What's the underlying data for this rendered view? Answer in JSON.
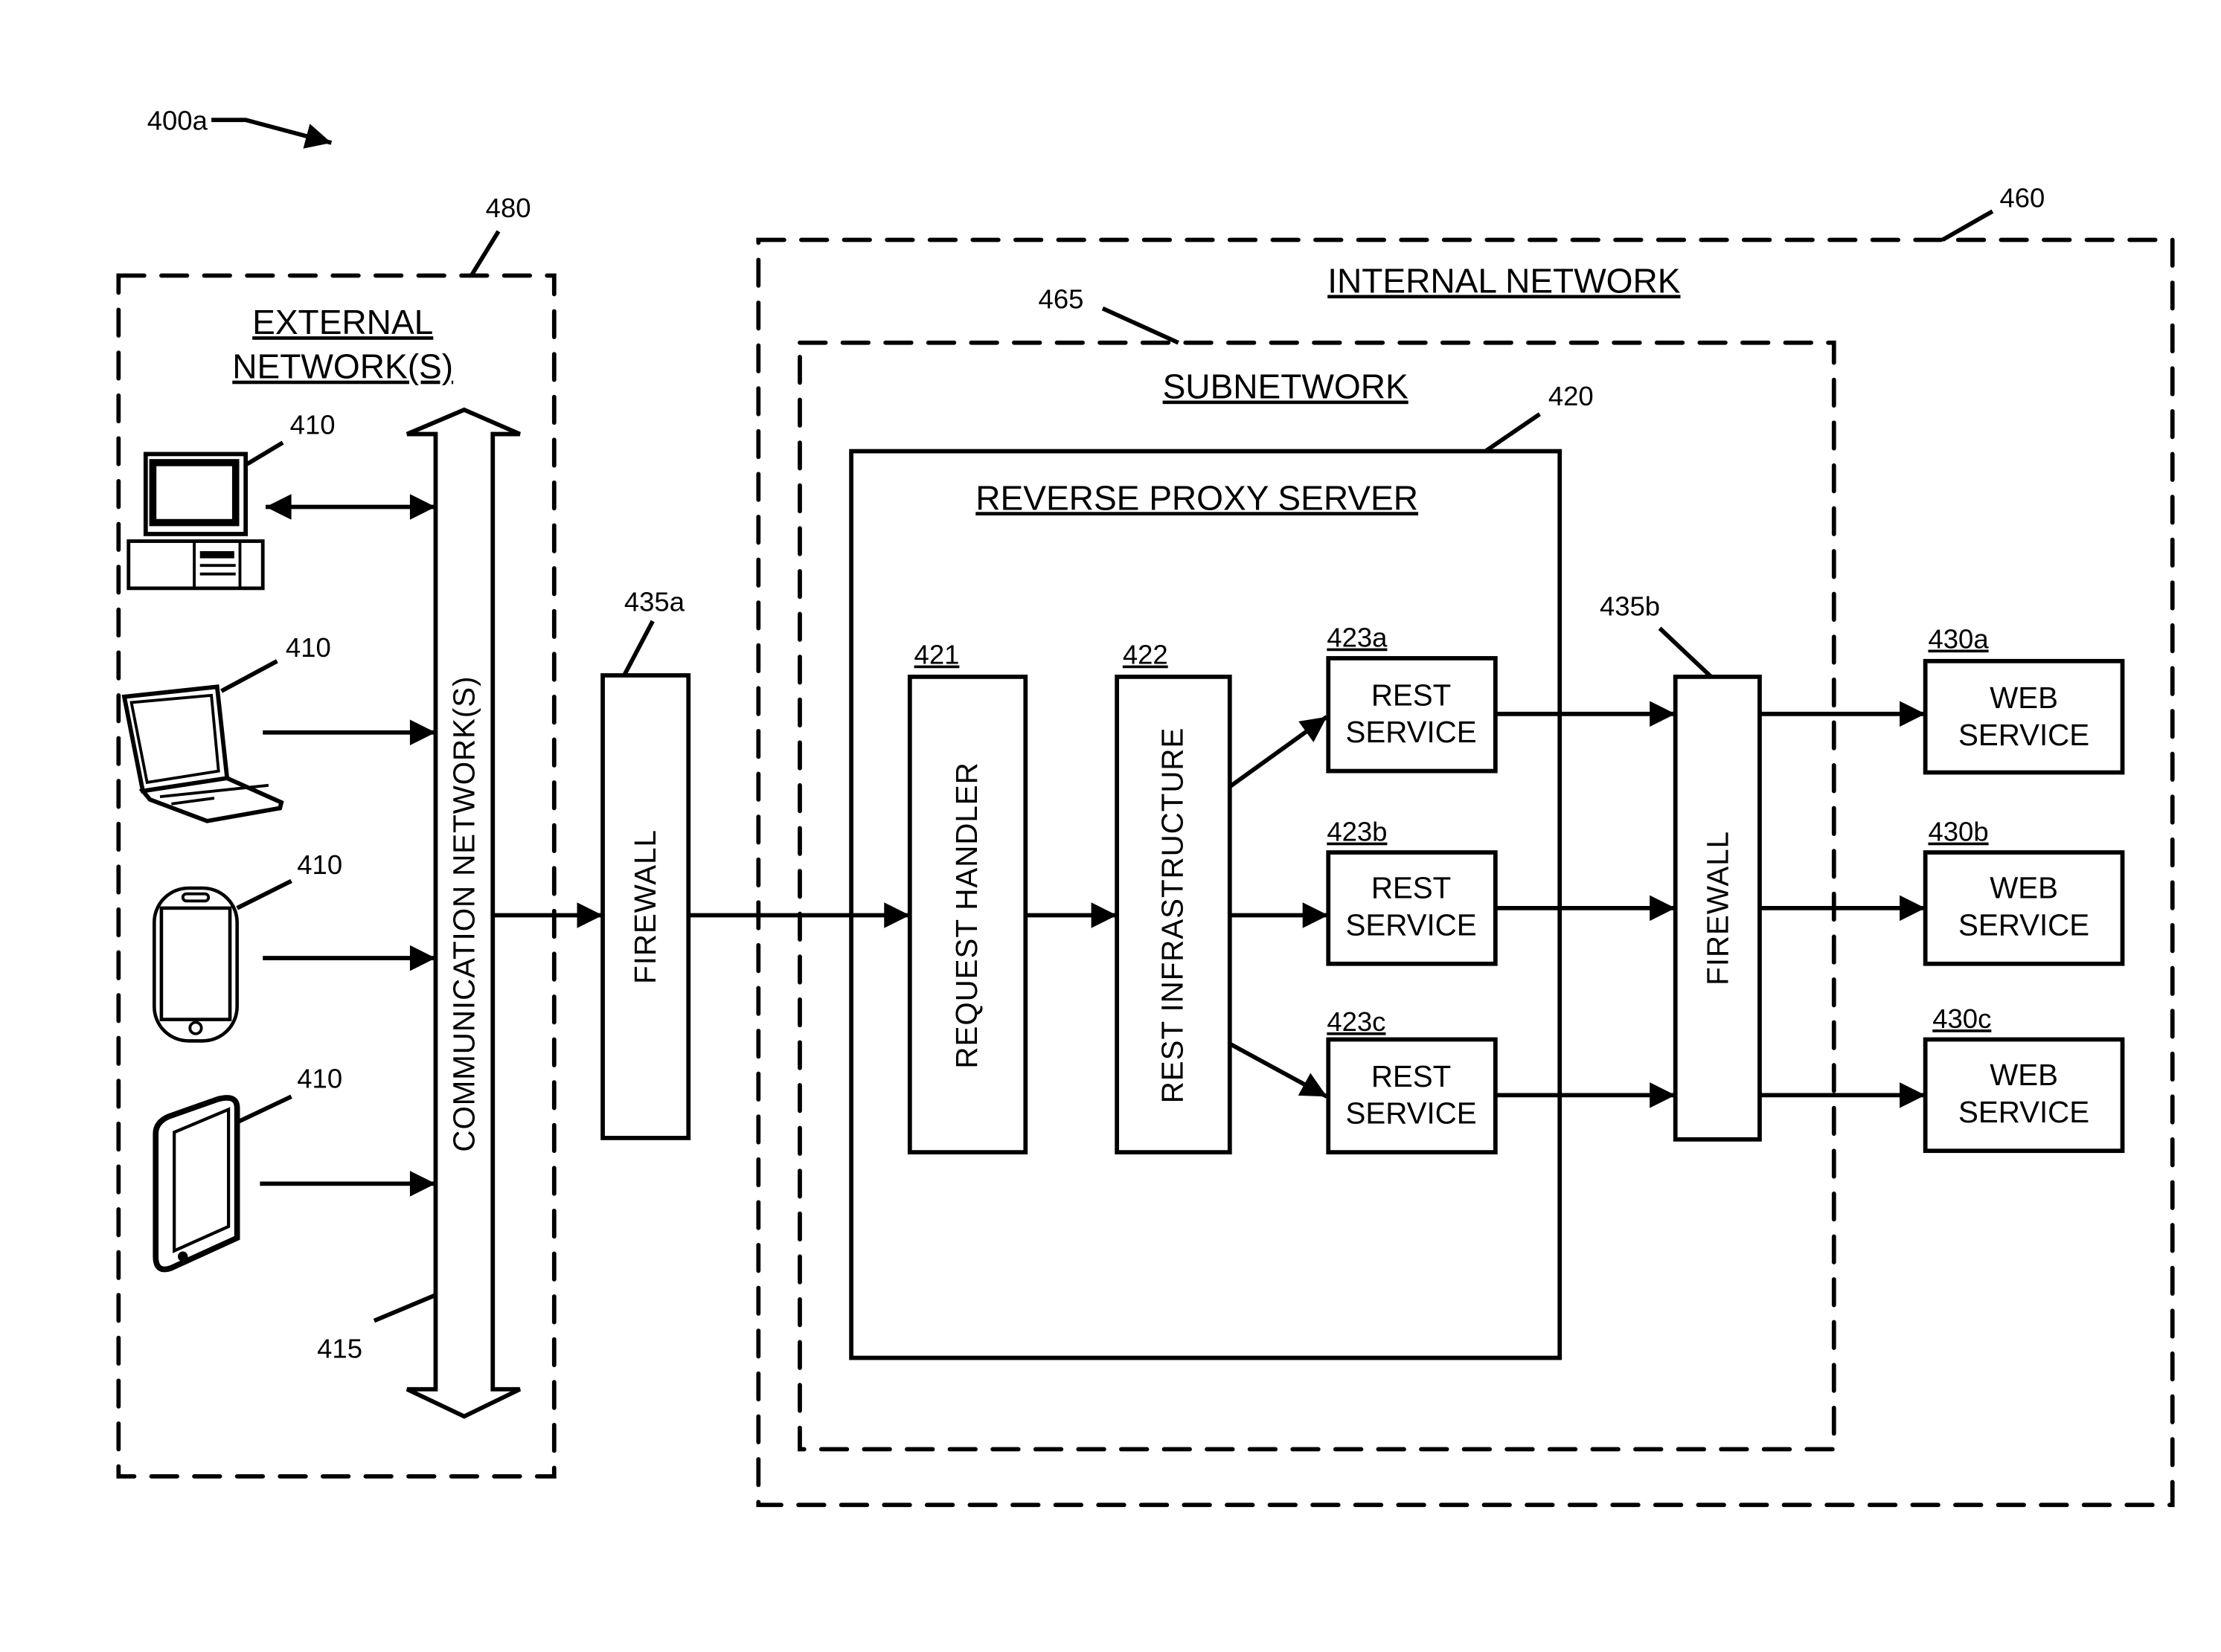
{
  "figure": {
    "ref": "400a"
  },
  "external_network": {
    "ref": "480",
    "title_line1": "EXTERNAL",
    "title_line2": "NETWORK(S)",
    "devices": [
      {
        "type": "desktop-computer",
        "ref": "410"
      },
      {
        "type": "laptop",
        "ref": "410"
      },
      {
        "type": "smartphone",
        "ref": "410"
      },
      {
        "type": "tablet",
        "ref": "410"
      }
    ],
    "communication_network": {
      "ref": "415",
      "label": "COMMUNICATION NETWORK(S)"
    }
  },
  "firewall_a": {
    "ref": "435a",
    "label": "FIREWALL"
  },
  "internal_network": {
    "ref": "460",
    "title": "INTERNAL NETWORK",
    "subnetwork": {
      "ref": "465",
      "title": "SUBNETWORK",
      "reverse_proxy": {
        "ref": "420",
        "title": "REVERSE PROXY SERVER",
        "request_handler": {
          "ref": "421",
          "label": "REQUEST HANDLER"
        },
        "rest_infrastructure": {
          "ref": "422",
          "label": "REST INFRASTRUCTURE"
        },
        "rest_services": [
          {
            "ref": "423a",
            "line1": "REST",
            "line2": "SERVICE"
          },
          {
            "ref": "423b",
            "line1": "REST",
            "line2": "SERVICE"
          },
          {
            "ref": "423c",
            "line1": "REST",
            "line2": "SERVICE"
          }
        ]
      }
    },
    "firewall_b": {
      "ref": "435b",
      "label": "FIREWALL"
    },
    "web_services": [
      {
        "ref": "430a",
        "line1": "WEB",
        "line2": "SERVICE"
      },
      {
        "ref": "430b",
        "line1": "WEB",
        "line2": "SERVICE"
      },
      {
        "ref": "430c",
        "line1": "WEB",
        "line2": "SERVICE"
      }
    ]
  }
}
